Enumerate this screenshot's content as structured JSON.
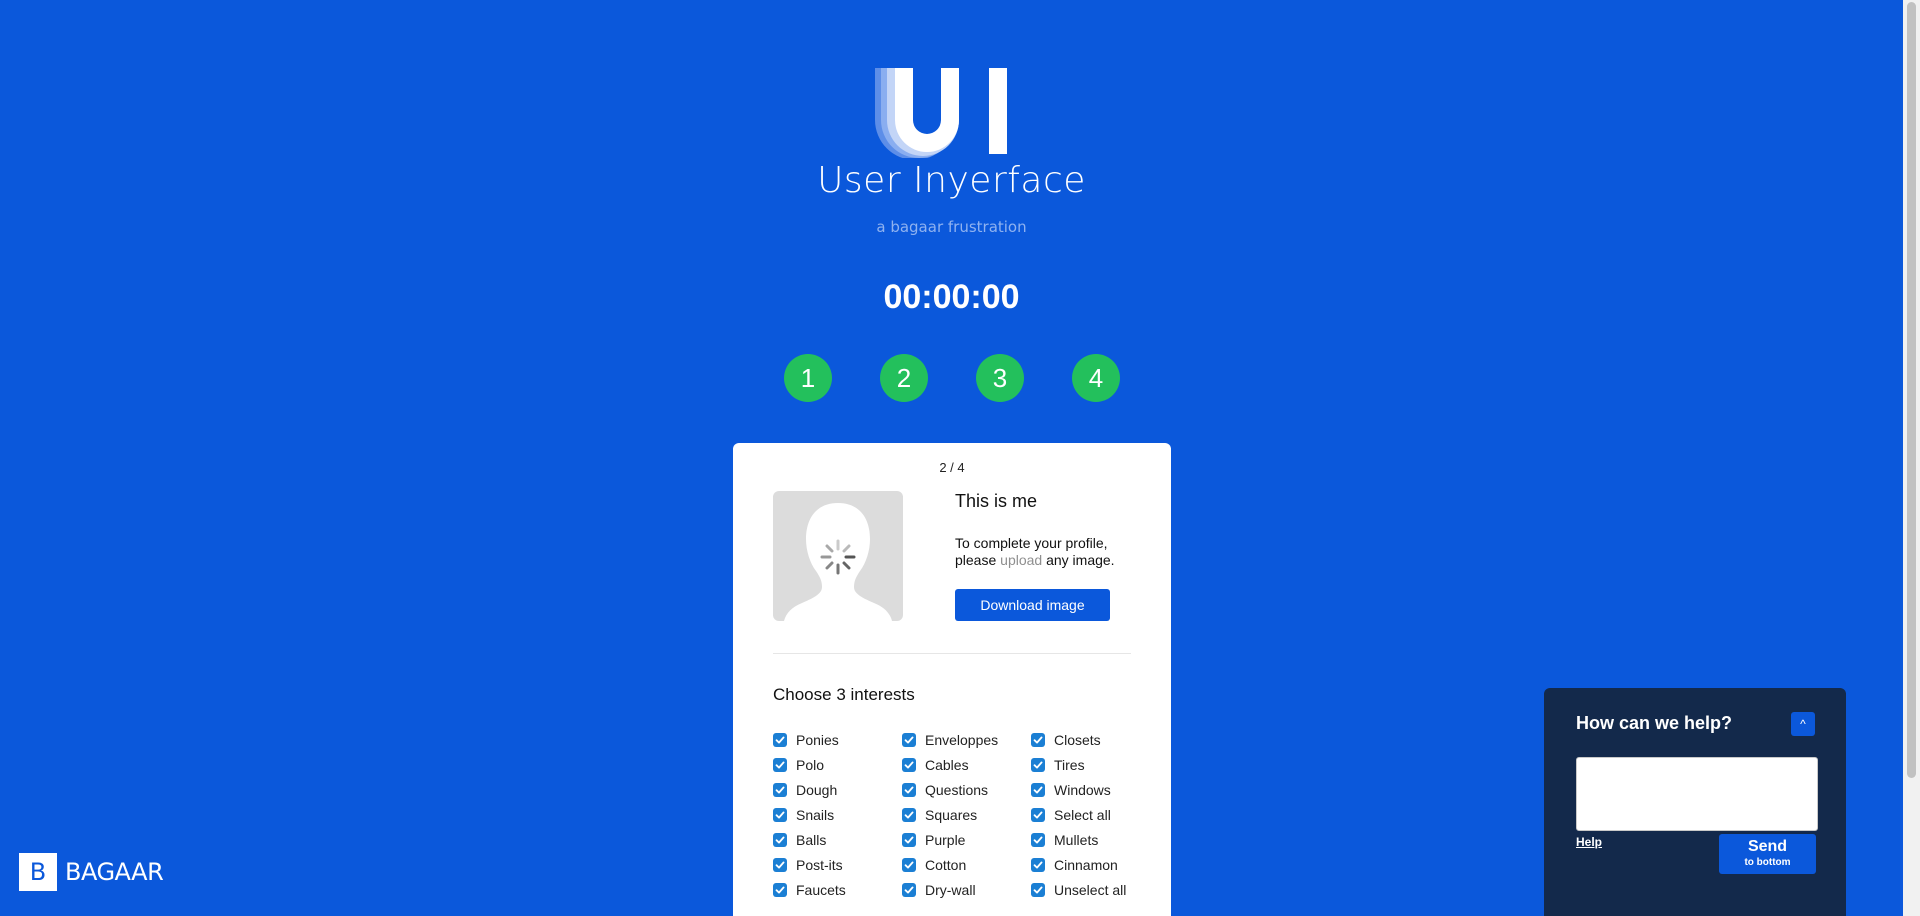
{
  "header": {
    "logo_text": "UI",
    "title": "User Inyerface",
    "subtitle": "a bagaar frustration",
    "timer": "00:00:00"
  },
  "steps": [
    "1",
    "2",
    "3",
    "4"
  ],
  "card": {
    "page_counter": "2 / 4",
    "section_title": "This is me",
    "instructions_prefix": "To complete your profile, please ",
    "instructions_link": "upload",
    "instructions_suffix": " any image.",
    "download_button": "Download image",
    "interests_title": "Choose 3 interests",
    "interests": [
      {
        "label": "Ponies",
        "checked": true
      },
      {
        "label": "Enveloppes",
        "checked": true
      },
      {
        "label": "Closets",
        "checked": true
      },
      {
        "label": "Polo",
        "checked": true
      },
      {
        "label": "Cables",
        "checked": true
      },
      {
        "label": "Tires",
        "checked": true
      },
      {
        "label": "Dough",
        "checked": true
      },
      {
        "label": "Questions",
        "checked": true
      },
      {
        "label": "Windows",
        "checked": true
      },
      {
        "label": "Snails",
        "checked": true
      },
      {
        "label": "Squares",
        "checked": true
      },
      {
        "label": "Select all",
        "checked": true
      },
      {
        "label": "Balls",
        "checked": true
      },
      {
        "label": "Purple",
        "checked": true
      },
      {
        "label": "Mullets",
        "checked": true
      },
      {
        "label": "Post-its",
        "checked": true
      },
      {
        "label": "Cotton",
        "checked": true
      },
      {
        "label": "Cinnamon",
        "checked": true
      },
      {
        "label": "Faucets",
        "checked": true
      },
      {
        "label": "Dry-wall",
        "checked": true
      },
      {
        "label": "Unselect all",
        "checked": true
      }
    ]
  },
  "help": {
    "title": "How can we help?",
    "toggle_icon": "^",
    "input_value": "",
    "help_link": "Help",
    "send_main": "Send",
    "send_sub": "to bottom"
  },
  "brand": {
    "letter": "B",
    "name": "BAGAAR"
  },
  "colors": {
    "background": "#0b58db",
    "step": "#23c05c",
    "checkbox": "#1b7fd4",
    "help_panel": "#13294b"
  }
}
